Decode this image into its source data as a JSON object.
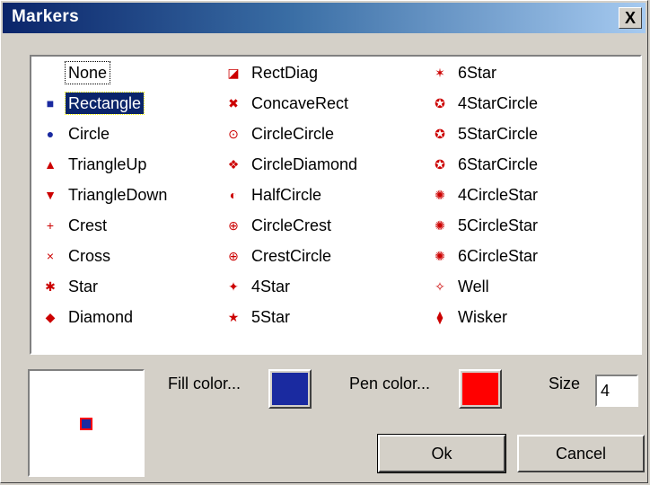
{
  "window": {
    "title": "Markers",
    "close_label": "X"
  },
  "markers": {
    "columns": [
      [
        {
          "name": "None",
          "glyph": ""
        },
        {
          "name": "Rectangle",
          "glyph": "■",
          "selected": true
        },
        {
          "name": "Circle",
          "glyph": "●"
        },
        {
          "name": "TriangleUp",
          "glyph": "▲"
        },
        {
          "name": "TriangleDown",
          "glyph": "▼"
        },
        {
          "name": "Crest",
          "glyph": "+"
        },
        {
          "name": "Cross",
          "glyph": "×"
        },
        {
          "name": "Star",
          "glyph": "✱"
        },
        {
          "name": "Diamond",
          "glyph": "◆"
        }
      ],
      [
        {
          "name": "RectDiag",
          "glyph": "◪"
        },
        {
          "name": "ConcaveRect",
          "glyph": "✖"
        },
        {
          "name": "CircleCircle",
          "glyph": "⊙"
        },
        {
          "name": "CircleDiamond",
          "glyph": "❖"
        },
        {
          "name": "HalfCircle",
          "glyph": "◐"
        },
        {
          "name": "CircleCrest",
          "glyph": "⊕"
        },
        {
          "name": "CrestCircle",
          "glyph": "⊕"
        },
        {
          "name": "4Star",
          "glyph": "✦"
        },
        {
          "name": "5Star",
          "glyph": "★"
        }
      ],
      [
        {
          "name": "6Star",
          "glyph": "✶"
        },
        {
          "name": "4StarCircle",
          "glyph": "✪"
        },
        {
          "name": "5StarCircle",
          "glyph": "✪"
        },
        {
          "name": "6StarCircle",
          "glyph": "✪"
        },
        {
          "name": "4CircleStar",
          "glyph": "✺"
        },
        {
          "name": "5CircleStar",
          "glyph": "✺"
        },
        {
          "name": "6CircleStar",
          "glyph": "✺"
        },
        {
          "name": "Well",
          "glyph": "✧"
        },
        {
          "name": "Wisker",
          "glyph": "⧫"
        }
      ]
    ]
  },
  "controls": {
    "fill_label": "Fill color...",
    "pen_label": "Pen color...",
    "size_label": "Size",
    "size_value": "4",
    "ok_label": "Ok",
    "cancel_label": "Cancel"
  },
  "colors": {
    "fill": "#1a2aa0",
    "pen": "#ff0000",
    "marker_red": "#cc0000",
    "marker_blue": "#1a2aa0"
  }
}
